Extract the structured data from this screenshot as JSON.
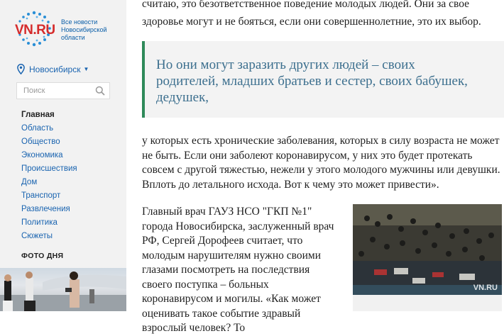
{
  "sidebar": {
    "logo": {
      "brand": "VN.RU",
      "tagline": "Все новости Новосибирской области"
    },
    "city": "Новосибирск",
    "search": {
      "placeholder": "Поиск"
    },
    "nav": [
      {
        "label": "Главная",
        "active": true
      },
      {
        "label": "Область"
      },
      {
        "label": "Общество"
      },
      {
        "label": "Экономика"
      },
      {
        "label": "Происшествия"
      },
      {
        "label": "Дом"
      },
      {
        "label": "Транспорт"
      },
      {
        "label": "Развлечения"
      },
      {
        "label": "Политика"
      },
      {
        "label": "Сюжеты"
      }
    ],
    "photo_of_day_title": "ФОТО ДНЯ"
  },
  "article": {
    "paragraph_top": "считаю, это безответственное поведение молодых людей. Они за свое здоровье могут и не бояться, если они совершеннолетние, это их выбор.",
    "quote": "Но они могут заразить других людей – своих родителей, младших братьев и сестер, своих бабушек, дедушек,",
    "paragraph_mid": "у которых есть хронические заболевания, которых в силу возраста не может не быть. Если они заболеют коронавирусом, у них это будет протекать совсем с другой тяжестью, нежели у этого молодого мужчины или девушки. Вплоть до летального исхода. Вот к чему это может привести».",
    "paragraph_low": "Главный врач ГАУЗ НСО \"ГКП №1\" города Новосибирска, заслуженный врач РФ, Сергей Дорофеев считает, что молодым нарушителям нужно своими глазами посмотреть на последствия своего поступка – больных коронавирусом и могилы. «Как может оценивать такое событие здравый взрослый человек? То",
    "image_watermark": "VN.RU"
  },
  "colors": {
    "brand_red": "#d52b2b",
    "link_blue": "#1a64b0",
    "quote_text": "#3c6f8e",
    "quote_border": "#2f8a5a"
  }
}
